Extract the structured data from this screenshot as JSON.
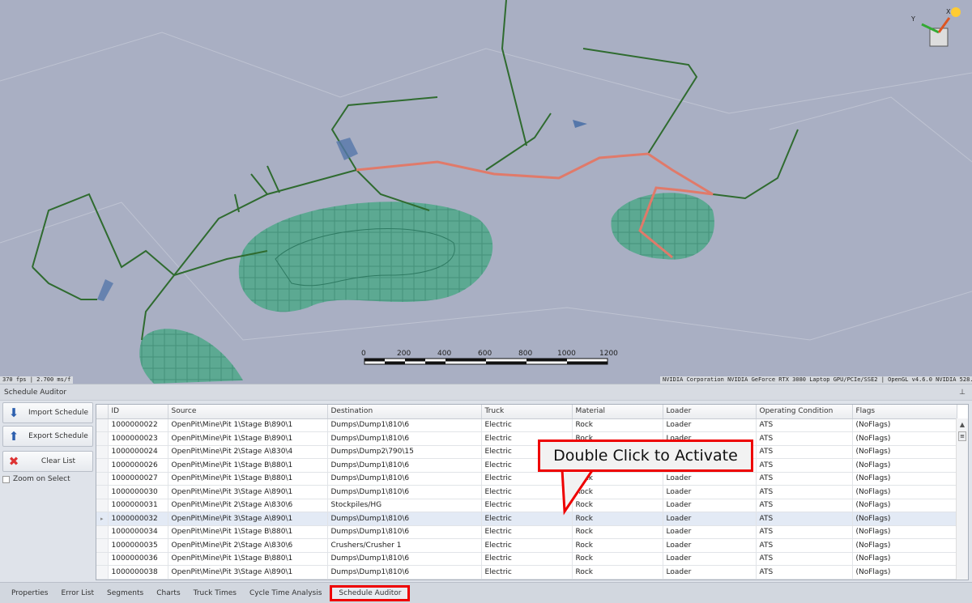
{
  "viewport": {
    "fps_readout": "370 fps | 2.700 ms/f",
    "gpu_readout": "NVIDIA Corporation NVIDIA GeForce RTX 3080 Laptop GPU/PCIe/SSE2 | OpenGL v4.6.0 NVIDIA 528.79",
    "scale_bar_ticks": [
      "0",
      "200",
      "400",
      "600",
      "800",
      "1000",
      "1200"
    ],
    "axis_labels": {
      "y": "Y",
      "x": "X"
    }
  },
  "panel": {
    "title": "Schedule Auditor",
    "pin_icon": "pin-icon",
    "buttons": {
      "import": "Import Schedule",
      "export": "Export Schedule",
      "clear": "Clear List"
    },
    "zoom_on_select": {
      "label": "Zoom on Select",
      "checked": false
    }
  },
  "table": {
    "columns": [
      "ID",
      "Source",
      "Destination",
      "Truck",
      "Material",
      "Loader",
      "Operating Condition",
      "Flags"
    ],
    "rows": [
      [
        "1000000022",
        "OpenPit\\Mine\\Pit 1\\Stage B\\890\\1",
        "Dumps\\Dump1\\810\\6",
        "Electric",
        "Rock",
        "Loader",
        "ATS",
        "(NoFlags)"
      ],
      [
        "1000000023",
        "OpenPit\\Mine\\Pit 1\\Stage B\\890\\1",
        "Dumps\\Dump1\\810\\6",
        "Electric",
        "Rock",
        "Loader",
        "ATS",
        "(NoFlags)"
      ],
      [
        "1000000024",
        "OpenPit\\Mine\\Pit 2\\Stage A\\830\\4",
        "Dumps\\Dump2\\790\\15",
        "Electric",
        "Rock",
        "Loader",
        "ATS",
        "(NoFlags)"
      ],
      [
        "1000000026",
        "OpenPit\\Mine\\Pit 1\\Stage B\\880\\1",
        "Dumps\\Dump1\\810\\6",
        "Electric",
        "Rock",
        "Loader",
        "ATS",
        "(NoFlags)"
      ],
      [
        "1000000027",
        "OpenPit\\Mine\\Pit 1\\Stage B\\880\\1",
        "Dumps\\Dump1\\810\\6",
        "Electric",
        "Rock",
        "Loader",
        "ATS",
        "(NoFlags)"
      ],
      [
        "1000000030",
        "OpenPit\\Mine\\Pit 3\\Stage A\\890\\1",
        "Dumps\\Dump1\\810\\6",
        "Electric",
        "Rock",
        "Loader",
        "ATS",
        "(NoFlags)"
      ],
      [
        "1000000031",
        "OpenPit\\Mine\\Pit 2\\Stage A\\830\\6",
        "Stockpiles/HG",
        "Electric",
        "Rock",
        "Loader",
        "ATS",
        "(NoFlags)"
      ],
      [
        "1000000032",
        "OpenPit\\Mine\\Pit 3\\Stage A\\890\\1",
        "Dumps\\Dump1\\810\\6",
        "Electric",
        "Rock",
        "Loader",
        "ATS",
        "(NoFlags)"
      ],
      [
        "1000000034",
        "OpenPit\\Mine\\Pit 1\\Stage B\\880\\1",
        "Dumps\\Dump1\\810\\6",
        "Electric",
        "Rock",
        "Loader",
        "ATS",
        "(NoFlags)"
      ],
      [
        "1000000035",
        "OpenPit\\Mine\\Pit 2\\Stage A\\830\\6",
        "Crushers/Crusher 1",
        "Electric",
        "Rock",
        "Loader",
        "ATS",
        "(NoFlags)"
      ],
      [
        "1000000036",
        "OpenPit\\Mine\\Pit 1\\Stage B\\880\\1",
        "Dumps\\Dump1\\810\\6",
        "Electric",
        "Rock",
        "Loader",
        "ATS",
        "(NoFlags)"
      ],
      [
        "1000000038",
        "OpenPit\\Mine\\Pit 3\\Stage A\\890\\1",
        "Dumps\\Dump1\\810\\6",
        "Electric",
        "Rock",
        "Loader",
        "ATS",
        "(NoFlags)"
      ]
    ],
    "selected_row_index": 7
  },
  "callout": {
    "text": "Double Click to Activate"
  },
  "bottom_tabs": [
    "Properties",
    "Error List",
    "Segments",
    "Charts",
    "Truck Times",
    "Cycle Time Analysis",
    "Schedule Auditor"
  ],
  "active_tab": "Schedule Auditor",
  "colors": {
    "highlight": "#e00000",
    "selected_row": "#e3eaf5",
    "terrain": "#a9afc3",
    "pit": "#4fa88a"
  }
}
